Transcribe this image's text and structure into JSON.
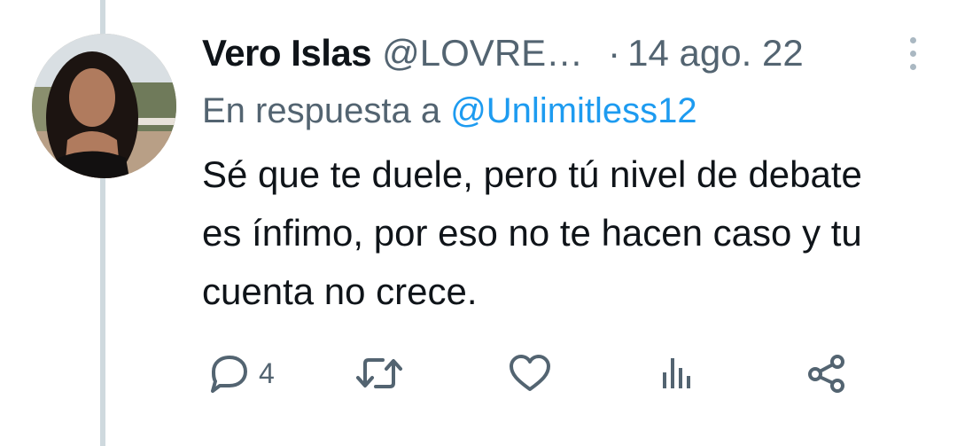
{
  "tweet": {
    "author_name": "Vero Islas",
    "author_handle": "@LOVRE…",
    "separator": "·",
    "date": "14 ago. 22",
    "reply_prefix": "En respuesta a ",
    "reply_to": "@Unlimitless12",
    "text": "Sé que te duele, pero tú nivel de debate es ínfimo, por eso no te hacen caso y tu cuenta no crece."
  },
  "actions": {
    "reply_count": "4",
    "icons": [
      "reply-icon",
      "retweet-icon",
      "like-icon",
      "views-icon",
      "share-icon"
    ]
  },
  "colors": {
    "text": "#0f1419",
    "secondary": "#536471",
    "link": "#1d9bf0",
    "thread_line": "#cfd9de"
  }
}
